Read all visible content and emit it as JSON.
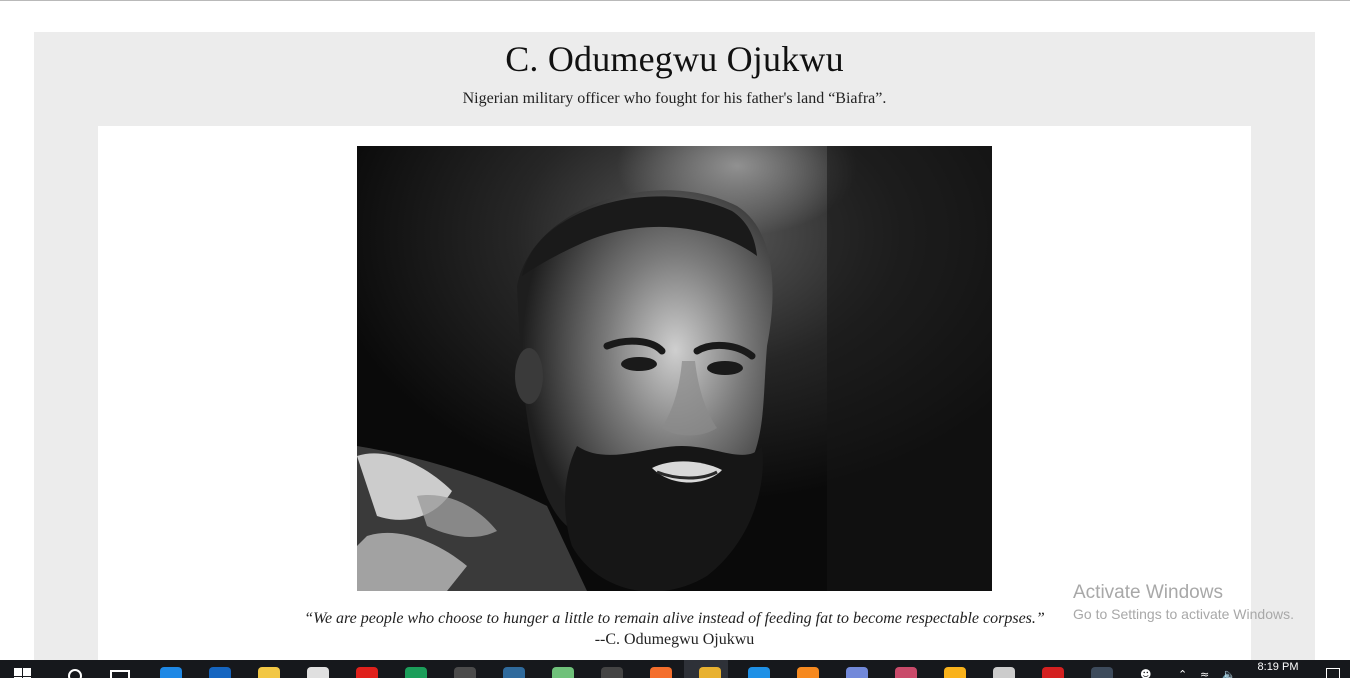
{
  "page": {
    "title": "C. Odumegwu Ojukwu",
    "subtitle": "Nigerian military officer who fought for his father's land “Biafra”."
  },
  "image": {
    "alt": "Black and white portrait of C. Odumegwu Ojukwu"
  },
  "quote": {
    "text": "“We are people who choose to hunger a little to remain alive instead of feeding fat to become respectable corpses.”",
    "author": "--C. Odumegwu Ojukwu"
  },
  "watermark": {
    "title": "Activate Windows",
    "subtitle": "Go to Settings to activate Windows."
  },
  "taskbar": {
    "time": "8:19 PM",
    "apps": [
      {
        "name": "edge-icon",
        "color": "#1e88e5"
      },
      {
        "name": "mail-icon",
        "color": "#1565c0"
      },
      {
        "name": "file-explorer-icon",
        "color": "#f2c744"
      },
      {
        "name": "store-icon",
        "color": "#e0e0e0"
      },
      {
        "name": "opera-icon",
        "color": "#e0201b"
      },
      {
        "name": "globe-icon",
        "color": "#1b9e5a"
      },
      {
        "name": "sublime-icon",
        "color": "#4b4b4b"
      },
      {
        "name": "mysql-workbench-icon",
        "color": "#2f6a9c"
      },
      {
        "name": "android-studio-icon",
        "color": "#6fc17a"
      },
      {
        "name": "terminal-icon",
        "color": "#444444"
      },
      {
        "name": "xampp-icon",
        "color": "#f46e2c"
      },
      {
        "name": "chrome-icon",
        "color": "#e8b130"
      },
      {
        "name": "vscode-icon",
        "color": "#1e90e6"
      },
      {
        "name": "firefox-icon",
        "color": "#f6891f"
      },
      {
        "name": "discord-icon",
        "color": "#7289da"
      },
      {
        "name": "paint-icon",
        "color": "#c94a6a"
      },
      {
        "name": "app-orange-icon",
        "color": "#f9b21b"
      },
      {
        "name": "github-icon",
        "color": "#cccccc"
      },
      {
        "name": "record-icon",
        "color": "#d42020"
      },
      {
        "name": "tool-icon",
        "color": "#3d4b5c"
      }
    ]
  }
}
